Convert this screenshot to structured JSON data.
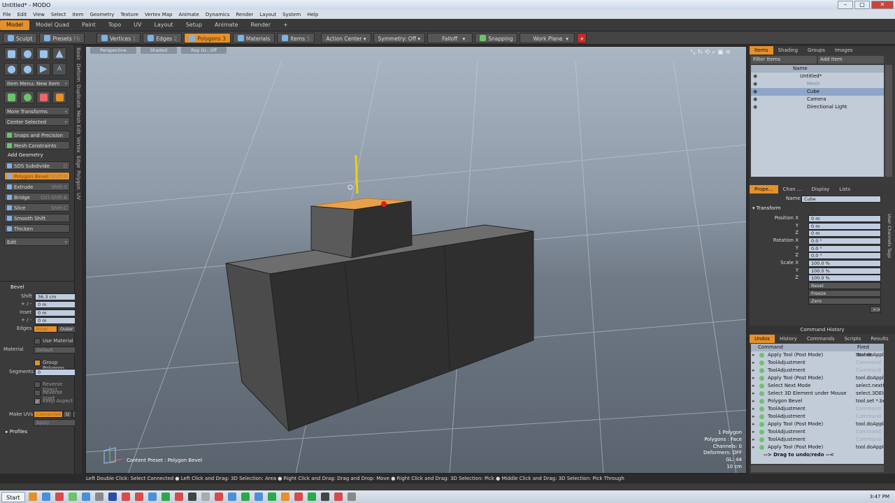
{
  "window": {
    "title": "Untitled* - MODO"
  },
  "menu": [
    "File",
    "Edit",
    "View",
    "Select",
    "Item",
    "Geometry",
    "Texture",
    "Vertex Map",
    "Animate",
    "Dynamics",
    "Render",
    "Layout",
    "System",
    "Help"
  ],
  "modetabs": [
    "Model",
    "Model Quad",
    "Paint",
    "Topo",
    "UV",
    "Layout",
    "Setup",
    "Animate",
    "Render"
  ],
  "modetabs_add": "+",
  "toolbar": {
    "sculpt": "Sculpt",
    "presets": "Presets",
    "presets_key": "F6",
    "vertices": "Vertices",
    "vertices_key": "1",
    "edges": "Edges",
    "edges_key": "2",
    "polygons": "Polygons",
    "polygons_key": "3",
    "materials": "Materials",
    "items": "Items",
    "items_key": "5",
    "action_center": "Action Center",
    "symmetry": "Symmetry: Off",
    "falloff": "Falloff",
    "snapping": "Snapping",
    "work_plane": "Work Plane"
  },
  "left": {
    "item_menu": "Item Menu: New Item",
    "more_transforms": "More Transforms",
    "center_selected": "Center Selected",
    "snaps_precision": "Snaps and Precision",
    "mesh_constraints": "Mesh Constraints",
    "add_geometry": "Add Geometry",
    "tools": [
      {
        "label": "SDS Subdivide",
        "key": "D"
      },
      {
        "label": "Polygon Bevel",
        "key": "Shift-B"
      },
      {
        "label": "Extrude",
        "key": "Shift-X"
      },
      {
        "label": "Bridge",
        "key": "Ctrl-Shift-B"
      },
      {
        "label": "Slice",
        "key": "Shift-C"
      },
      {
        "label": "Smooth Shift",
        "key": ""
      },
      {
        "label": "Thicken",
        "key": ""
      }
    ],
    "edit": "Edit",
    "vtabs": [
      "Basic",
      "Deform",
      "Duplicate",
      "Mesh Edit",
      "Vertex",
      "Edge",
      "Polygon",
      "UV"
    ]
  },
  "bevel": {
    "title": "Bevel",
    "shift_label": "Shift",
    "shift_value": "36.3 cm",
    "shift_pm_label": "+ / -",
    "shift_pm_value": "0 m",
    "inset_label": "Inset",
    "inset_value": "0 m",
    "inset_pm_label": "+ / -",
    "inset_pm_value": "0 m",
    "edges_label": "Edges",
    "edges_inner": "Inner",
    "edges_outer": "Outer",
    "use_material": "Use Material",
    "material_label": "Material",
    "material_value": "Default",
    "group_polygons": "Group Polygons",
    "segments_label": "Segments",
    "segments_value": "0",
    "reverse_direction": "Reverse Direct...",
    "reverse_inset": "Reverse Inset",
    "keep_aspect": "Keep Aspect",
    "make_uvs_label": "Make UVs",
    "make_uvs_value": "Connected",
    "uv_btn": "U",
    "v_btn": "V",
    "apply": "Apply",
    "profiles": "Profiles"
  },
  "viewport": {
    "tabs": [
      "Perspective",
      "Shaded",
      "Ray GL: Off"
    ],
    "content_preset": "Content Preset : Polygon Bevel",
    "stats": [
      "1 Polygon",
      "Polygons : Face",
      "Channels: 0",
      "Deformers: OFF",
      "GL: 44",
      "10 cm"
    ]
  },
  "items_panel": {
    "tabs": [
      "Items",
      "Shading",
      "Groups",
      "Images"
    ],
    "filter": "Filter Items",
    "add_item": "Add Item",
    "column_name": "Name",
    "tree": [
      {
        "label": "Untitled*",
        "level": 0
      },
      {
        "label": "Mesh",
        "level": 1
      },
      {
        "label": "Cube",
        "level": 1
      },
      {
        "label": "Camera",
        "level": 1
      },
      {
        "label": "Directional Light",
        "level": 1
      }
    ]
  },
  "properties": {
    "tabs": [
      "Prope...",
      "Chan ...",
      "Display",
      "Lists"
    ],
    "name_label": "Name",
    "name_value": "Cube",
    "transform": "Transform",
    "position_label": "Position X",
    "rotation_label": "Rotation X",
    "scale_label": "Scale X",
    "y_label": "Y",
    "z_label": "Z",
    "position": [
      "0 m",
      "0 m",
      "0 m"
    ],
    "rotation": [
      "0.0 °",
      "0.0 °",
      "0.0 °"
    ],
    "scale": [
      "100.0 %",
      "100.0 %",
      "100.0 %"
    ],
    "reset": "Reset",
    "freeze": "Freeze",
    "zero": "Zero",
    "more": ">>",
    "side_tabs": "User Channels  Tags"
  },
  "command_history": {
    "title": "Command History",
    "tabs": [
      "Undos",
      "History",
      "Commands",
      "Scripts",
      "Results"
    ],
    "col_command": "Command",
    "col_fired": "Fired Name",
    "rows": [
      {
        "cmd": "Apply Tool (Post Mode)",
        "fired": "tool.doApply"
      },
      {
        "cmd": "ToolAdjustment",
        "fired": "Command"
      },
      {
        "cmd": "ToolAdjustment",
        "fired": "Command"
      },
      {
        "cmd": "Apply Tool (Post Mode)",
        "fired": "tool.doApply"
      },
      {
        "cmd": "Select Next Mode",
        "fired": "select.nextM"
      },
      {
        "cmd": "Select 3D Element under Mouse",
        "fired": "select.3DEle"
      },
      {
        "cmd": "Polygon Bevel",
        "fired": "tool.set *.be"
      },
      {
        "cmd": "ToolAdjustment",
        "fired": "Command"
      },
      {
        "cmd": "ToolAdjustment",
        "fired": "Command"
      },
      {
        "cmd": "Apply Tool (Post Mode)",
        "fired": "tool.doApply"
      },
      {
        "cmd": "ToolAdjustment",
        "fired": "Command"
      },
      {
        "cmd": "ToolAdjustment",
        "fired": "Command"
      },
      {
        "cmd": "Apply Tool (Post Mode)",
        "fired": "tool.doApply"
      }
    ],
    "drag_hint": "--> Drag to undo/redo --<"
  },
  "statusbar": "Left Double Click: Select Connected ● Left Click and Drag: 3D Selection: Area ● Right Click and Drag: Drag and Drop: Move ● Right Click and Drag: 3D Selection: Pick ● Middle Click and Drag: 3D Selection: Pick Through",
  "taskbar": {
    "start": "Start",
    "clock": "3:47 PM"
  },
  "colors": {
    "accent": "#e6902a",
    "panel": "#3b3b3b",
    "list_bg": "#c2ccd8"
  }
}
